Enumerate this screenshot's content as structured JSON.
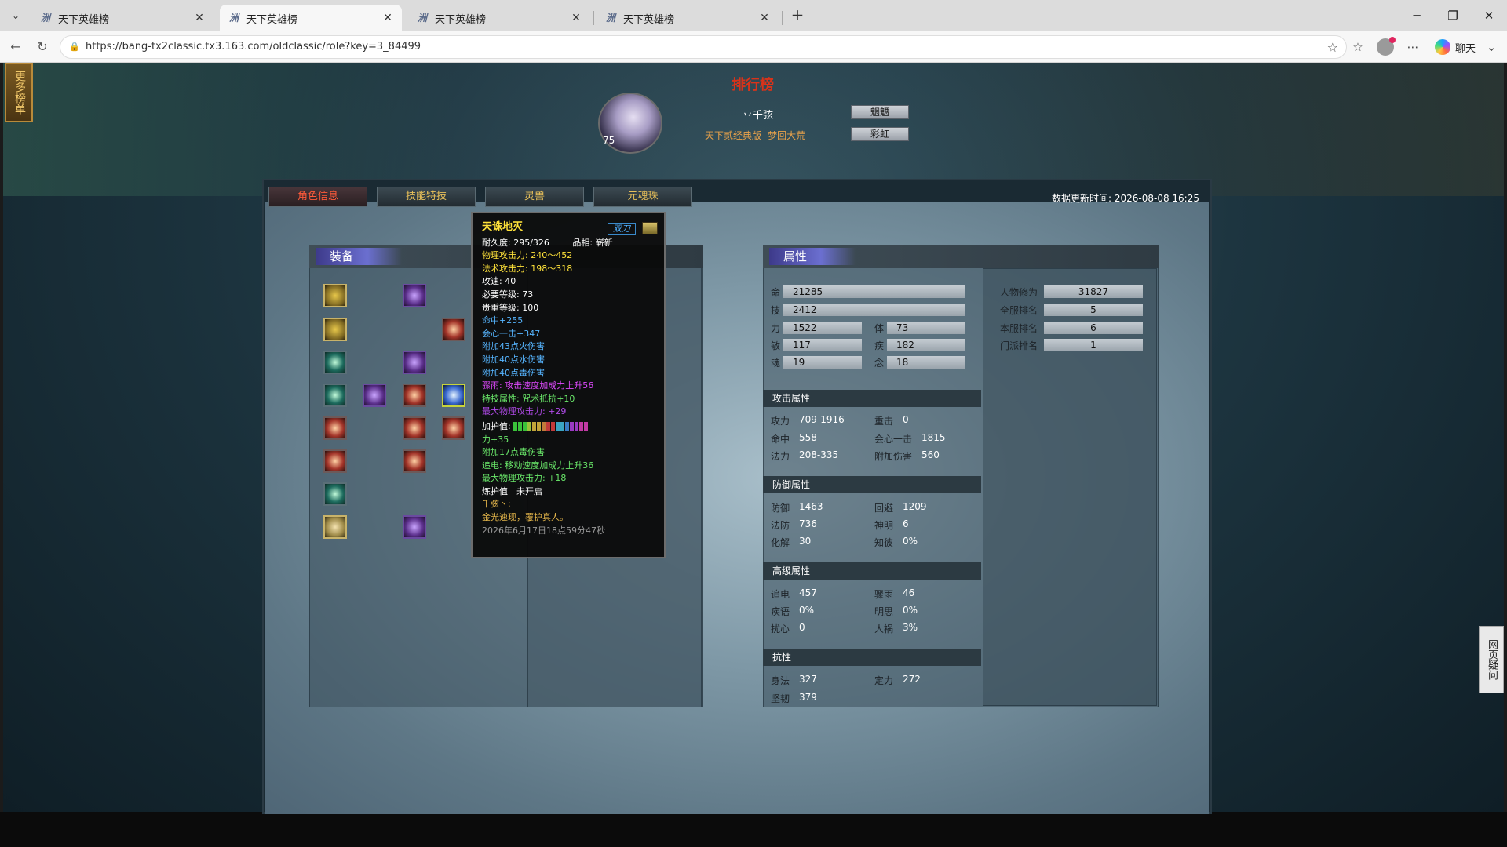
{
  "browser": {
    "tabs": [
      {
        "title": "天下英雄榜",
        "active": false
      },
      {
        "title": "天下英雄榜",
        "active": true
      },
      {
        "title": "天下英雄榜",
        "active": false
      },
      {
        "title": "天下英雄榜",
        "active": false
      }
    ],
    "url": "https://bang-tx2classic.tx3.163.com/oldclassic/role?key=3_84499",
    "chat_label": "聊天"
  },
  "page": {
    "side_badge": "更多榜单",
    "side_faq": "网页疑问",
    "rank_title": "排行榜",
    "character": {
      "level": "75",
      "name": "丷千弦",
      "server": "天下贰经典版- 梦回大荒",
      "button1": "魍魉",
      "button2": "彩虹"
    },
    "tabs": [
      {
        "label": "角色信息",
        "active": true
      },
      {
        "label": "技能特技",
        "active": false
      },
      {
        "label": "灵兽",
        "active": false
      },
      {
        "label": "元魂珠",
        "active": false
      }
    ],
    "update_time_label": "数据更新时间: 2026-08-08 16:25",
    "equip_header": "装备",
    "attr_header": "属性",
    "tooltip": {
      "name": "天诛地灭",
      "badge": "双刀",
      "lines": {
        "durability": "耐久度: 295/326",
        "quality": "品相: 崭新",
        "phys_atk": "物理攻击力: 240～452",
        "magic_atk": "法术攻击力: 198～318",
        "speed": "攻速: 40",
        "req_level": "必要等级: 73",
        "rarity": "贵重等级: 100",
        "hit": "命中+255",
        "crit": "会心一击+347",
        "fire": "附加43点火伤害",
        "water": "附加40点水伤害",
        "poison": "附加40点毒伤害",
        "rain": "骤雨: 攻击速度加成力上升56",
        "special": "特技属性: 咒术抵抗+10",
        "max_phys": "最大物理攻击力: +29",
        "guard_label": "加护值:",
        "guard_tail": "力+35",
        "poison2": "附加17点毒伤害",
        "chase": "追电: 移动速度加成力上升36",
        "max_phys2": "最大物理攻击力: +18",
        "refine": "炼护值　未开启",
        "owner": "千弦丶:",
        "motto": "金光速现，覆护真人。",
        "date": "2026年6月17日18点59分47秒"
      }
    },
    "base_stats": {
      "ming": {
        "label": "命",
        "value": "21285"
      },
      "ji": {
        "label": "技",
        "value": "2412"
      },
      "li": {
        "label": "力",
        "value": "1522"
      },
      "ti": {
        "label": "体",
        "value": "73"
      },
      "min": {
        "label": "敏",
        "value": "117"
      },
      "ji2": {
        "label": "疾",
        "value": "182"
      },
      "hun": {
        "label": "魂",
        "value": "19"
      },
      "nian": {
        "label": "念",
        "value": "18"
      }
    },
    "rank_stats": [
      {
        "label": "人物修为",
        "value": "31827"
      },
      {
        "label": "全服排名",
        "value": "5"
      },
      {
        "label": "本服排名",
        "value": "6"
      },
      {
        "label": "门派排名",
        "value": "1"
      }
    ],
    "attack": {
      "title": "攻击属性",
      "rows": [
        {
          "l1": "攻力",
          "v1": "709-1916",
          "l2": "重击",
          "v2": "0"
        },
        {
          "l1": "命中",
          "v1": "558",
          "l2": "会心一击",
          "v2": "1815"
        },
        {
          "l1": "法力",
          "v1": "208-335",
          "l2": "附加伤害",
          "v2": "560"
        }
      ]
    },
    "defense": {
      "title": "防御属性",
      "rows": [
        {
          "l1": "防御",
          "v1": "1463",
          "l2": "回避",
          "v2": "1209"
        },
        {
          "l1": "法防",
          "v1": "736",
          "l2": "神明",
          "v2": "6"
        },
        {
          "l1": "化解",
          "v1": "30",
          "l2": "知彼",
          "v2": "0%"
        }
      ]
    },
    "advanced": {
      "title": "高级属性",
      "rows": [
        {
          "l1": "追电",
          "v1": "457",
          "l2": "骤雨",
          "v2": "46"
        },
        {
          "l1": "疾语",
          "v1": "0%",
          "l2": "明思",
          "v2": "0%"
        },
        {
          "l1": "扰心",
          "v1": "0",
          "l2": "人祸",
          "v2": "3%"
        }
      ]
    },
    "resist": {
      "title": "抗性",
      "rows": [
        {
          "l1": "身法",
          "v1": "327",
          "l2": "定力",
          "v2": "272"
        },
        {
          "l1": "坚韧",
          "v1": "379",
          "l2": "",
          "v2": ""
        }
      ]
    },
    "colors": {
      "rank_title": "#d8331a",
      "tab_active": "#ff5a3a",
      "tab_text": "#e8c05a",
      "tooltip_name": "#ffe23a"
    }
  }
}
